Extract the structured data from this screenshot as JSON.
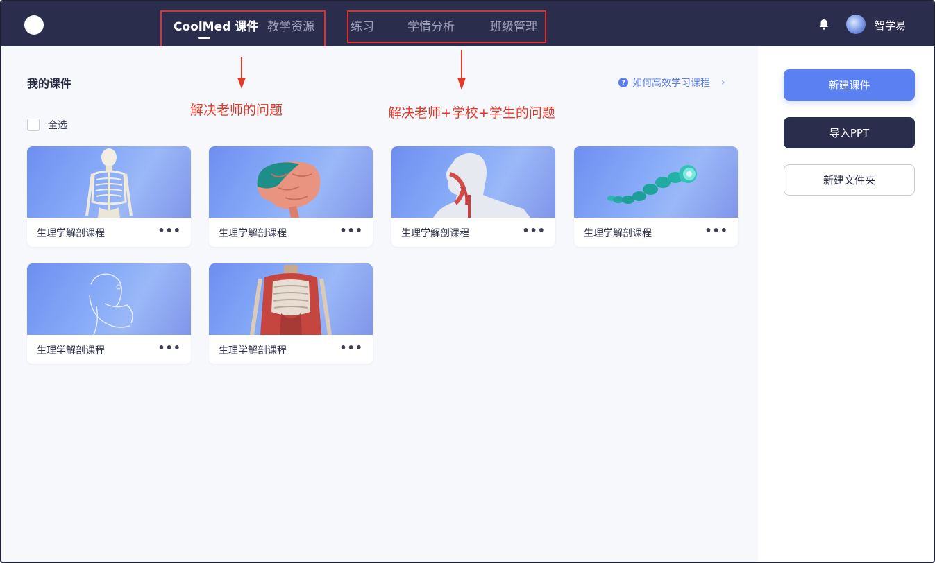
{
  "nav": {
    "items": [
      {
        "label": "CoolMed 课件",
        "active": true
      },
      {
        "label": "教学资源",
        "active": false
      },
      {
        "label": "练习",
        "active": false
      },
      {
        "label": "学情分析",
        "active": false
      },
      {
        "label": "班级管理",
        "active": false
      }
    ],
    "username": "智学易",
    "icons": {
      "bell": "bell-icon",
      "avatar": "avatar"
    }
  },
  "colors": {
    "nav_bg": "#2b2d4d",
    "accent": "#5b80f2",
    "annotation": "#e03a2a"
  },
  "main": {
    "section_title": "我的课件",
    "help_link": "如何高效学习课程",
    "select_all": "全选",
    "cards": [
      {
        "title": "生理学解剖课程",
        "more": "•••",
        "image": "skeleton"
      },
      {
        "title": "生理学解剖课程",
        "more": "•••",
        "image": "brain"
      },
      {
        "title": "生理学解剖课程",
        "more": "•••",
        "image": "head-section"
      },
      {
        "title": "生理学解剖课程",
        "more": "•••",
        "image": "molecule-chain"
      },
      {
        "title": "生理学解剖课程",
        "more": "•••",
        "image": "outline-figure"
      },
      {
        "title": "生理学解剖课程",
        "more": "•••",
        "image": "torso"
      }
    ]
  },
  "annotations": {
    "left": "解决老师的问题",
    "right": "解决老师+学校+学生的问题"
  },
  "sidebar": {
    "new_course": "新建课件",
    "import_ppt": "导入PPT",
    "new_folder": "新建文件夹"
  }
}
